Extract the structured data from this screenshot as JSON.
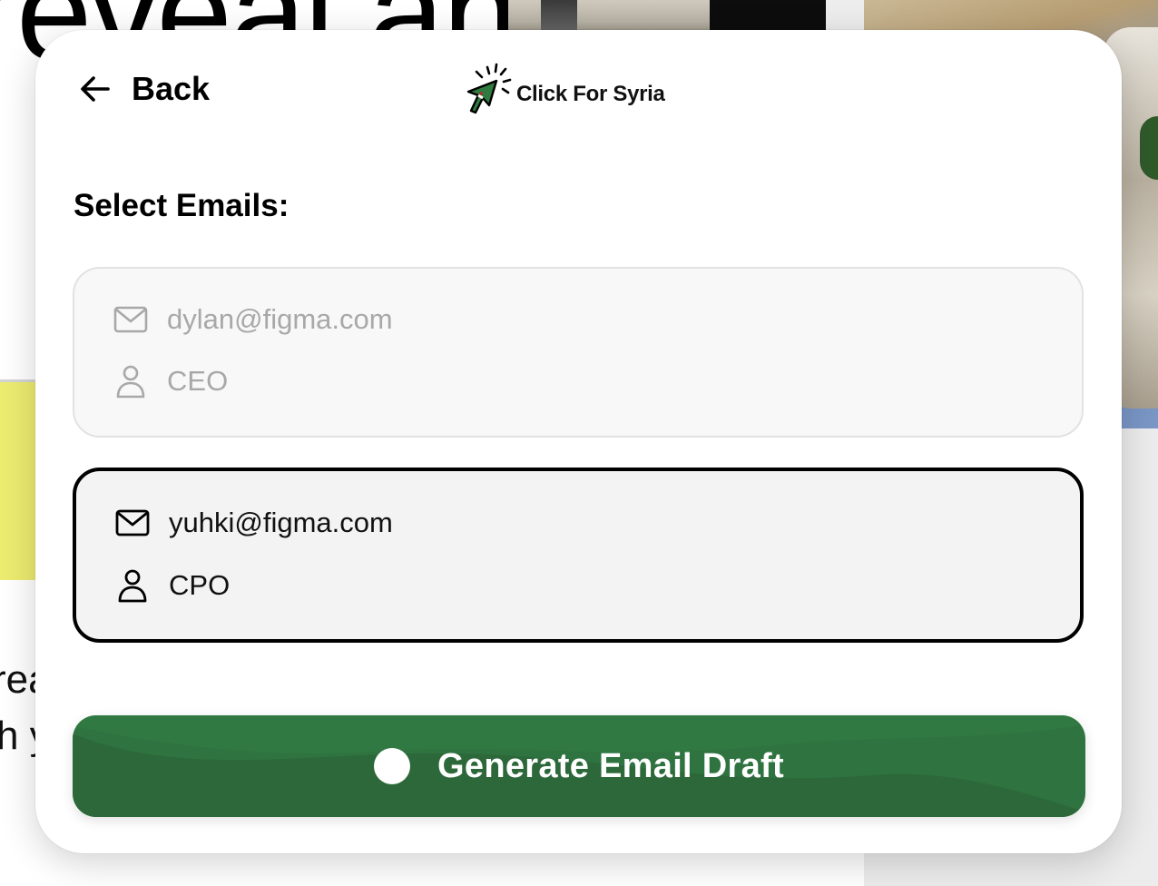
{
  "background": {
    "heading_fragment": "reveal an",
    "text_line_1": "rea",
    "text_line_2": "h y"
  },
  "header": {
    "back_label": "Back",
    "logo_text": "Click For Syria"
  },
  "section_title": "Select Emails:",
  "contacts": [
    {
      "email": "dylan@figma.com",
      "role": "CEO",
      "selected": false
    },
    {
      "email": "yuhki@figma.com",
      "role": "CPO",
      "selected": true
    }
  ],
  "generate_button": {
    "label": "Generate Email Draft"
  },
  "colors": {
    "button_green": "#2f7340",
    "selected_border": "#000000",
    "muted_text": "#a8a8a8"
  },
  "icons": {
    "back": "arrow-left-icon",
    "email": "mail-icon",
    "role": "user-icon",
    "logo": "cursor-click-icon"
  }
}
